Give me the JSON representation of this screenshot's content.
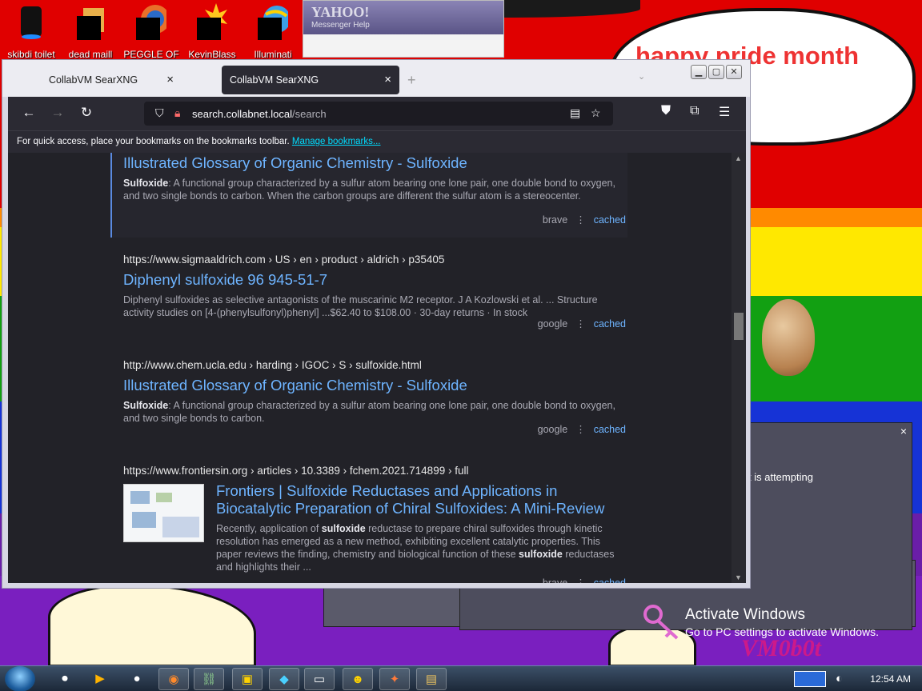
{
  "desktop": {
    "icons": [
      {
        "label": "skibdi toilet",
        "icon": "trash-bin-icon"
      },
      {
        "label": "dead maill",
        "icon": "folder-icon"
      },
      {
        "label": "PEGGLE OF",
        "icon": "firefox-icon"
      },
      {
        "label": "KevinBlass",
        "icon": "starburst-icon"
      },
      {
        "label": "Illuminati",
        "icon": "ie-globe-icon"
      }
    ],
    "yahoo": {
      "brand": "YAHOO!",
      "sub": "Messenger   Help"
    },
    "speech_text": "happy pride month",
    "dialog_message": "t is attempting",
    "dialog_close": "×",
    "activate": {
      "title": "Activate Windows",
      "subtitle": "Go to PC settings to activate Windows."
    },
    "vm_tag": "VM0b0t"
  },
  "browser": {
    "tabs": [
      {
        "label": "CollabVM SearXNG",
        "close": "×"
      },
      {
        "label": "CollabVM SearXNG",
        "close": "×"
      }
    ],
    "new_tab": "+",
    "url_host": "search.collabnet.local",
    "url_path": "/search",
    "bookmarks_hint": "For quick access, place your bookmarks on the bookmarks toolbar.",
    "bookmarks_link": "Manage bookmarks...",
    "results": [
      {
        "url": "",
        "title": "Illustrated Glossary of Organic Chemistry - Sulfoxide",
        "snippet_bold": "Sulfoxide",
        "snippet": ": A functional group characterized by a sulfur atom bearing one lone pair, one double bond to oxygen, and two single bonds to carbon. When the carbon groups are different the sulfur atom is a stereocenter.",
        "engine": "brave",
        "cached": "cached"
      },
      {
        "url": "https://www.sigmaaldrich.com  › US › en › product › aldrich › p35405",
        "title": "Diphenyl sulfoxide 96 945-51-7",
        "snippet_bold": "",
        "snippet": "Diphenyl sulfoxides as selective antagonists of the muscarinic M2 receptor. J A Kozlowski et al. ... Structure activity studies on [4-(phenylsulfonyl)phenyl] ...$62.40 to $108.00 · 30-day returns · In stock",
        "engine": "google",
        "cached": "cached"
      },
      {
        "url": "http://www.chem.ucla.edu  › harding › IGOC › S › sulfoxide.html",
        "title": "Illustrated Glossary of Organic Chemistry - Sulfoxide",
        "snippet_bold": "Sulfoxide",
        "snippet": ": A functional group characterized by a sulfur atom bearing one lone pair, one double bond to oxygen, and two single bonds to carbon.",
        "engine": "google",
        "cached": "cached"
      },
      {
        "url": "https://www.frontiersin.org  › articles › 10.3389 › fchem.2021.714899 › full",
        "title": "Frontiers | Sulfoxide Reductases and Applications in Biocatalytic Preparation of Chiral Sulfoxides: A Mini-Review",
        "snippet_a": "Recently, application of ",
        "snippet_b1": "sulfoxide",
        "snippet_c": " reductase to prepare chiral sulfoxides through kinetic resolution has emerged as a new method, exhibiting excellent catalytic properties. This paper reviews the finding, chemistry and biological function of these ",
        "snippet_b2": "sulfoxide",
        "snippet_d": " reductases and highlights their ...",
        "engine": "brave",
        "cached": "cached"
      }
    ]
  },
  "taskbar": {
    "clock": "12:54 AM",
    "buttons": [
      "media-icon",
      "player-icon",
      "app-icon",
      "firefox-icon",
      "network-icon",
      "terminal-icon",
      "gem-icon",
      "monitor-icon",
      "emoji-icon",
      "star-icon",
      "folder-icon"
    ]
  },
  "colors": {
    "wallpaper_red": "#e00000",
    "link": "#6eb4ff",
    "chrome_dark": "#2b2a33"
  }
}
